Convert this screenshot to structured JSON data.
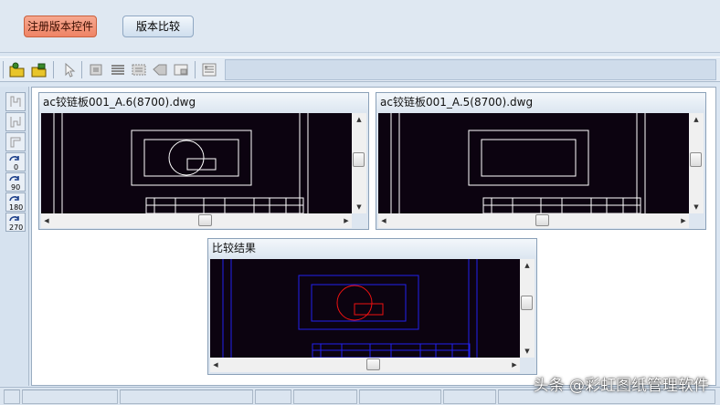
{
  "top_panel": {
    "register_button": "注册版本控件",
    "compare_button": "版本比较"
  },
  "toolbar": {
    "icons": [
      "open-icon",
      "save-icon",
      "select-icon",
      "rectangle-icon",
      "layers-icon",
      "dimension-icon",
      "shape-icon",
      "frame-icon",
      "properties-icon"
    ]
  },
  "left_bar": {
    "icons": [
      "align-icon-1",
      "align-icon-2",
      "align-icon-3",
      "rotate-0-icon",
      "rotate-90-icon",
      "rotate-180-icon",
      "rotate-270-icon"
    ],
    "labels": [
      "0",
      "90",
      "180",
      "270"
    ]
  },
  "windows": {
    "left_title": "ac铰链板001_A.6(8700).dwg",
    "right_title": "ac铰链板001_A.5(8700).dwg",
    "result_title": "比较结果"
  },
  "colors": {
    "register_button": "#ef8466",
    "canvas_bg": "#0c0310",
    "drawing_line": "#ffffff",
    "result_line": "#2222ee",
    "diff_line": "#ee1111"
  },
  "watermark": "头条 @彩虹图纸管理软件"
}
